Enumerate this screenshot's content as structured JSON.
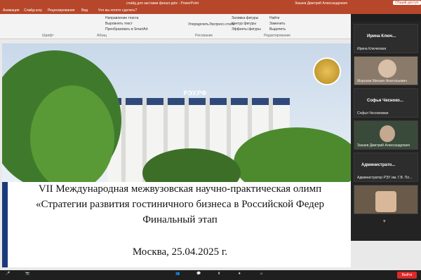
{
  "window": {
    "document_title": "слайд для заставки финал.pptx - PowerPoint",
    "user_name": "Закаев Дмитрий Александрович",
    "share_label": "Общий доступ"
  },
  "menu": {
    "items": [
      "Анимация",
      "Слайд-шоу",
      "Рецензирование",
      "Вид",
      "Что вы хотите сделать?"
    ]
  },
  "ribbon": {
    "groups": [
      "Шрифт",
      "Абзац",
      "Рисование",
      "Редактирование"
    ],
    "buttons": [
      "Направление текста",
      "Выровнять текст",
      "Преобразовать в SmartArt",
      "Упорядочить",
      "Экспресс-стили",
      "Заливка фигуры",
      "Контур фигуры",
      "Эффекты фигуры",
      "Найти",
      "Заменить",
      "Выделить"
    ]
  },
  "slide": {
    "sign_text": "РЭУ.РФ",
    "line1": "VII Международная межвузовская научно-практическая олимп",
    "line2": "«Стратегии развития гостиничного бизнеса в Российской Федер",
    "line3": "Финальный этап",
    "line4": "Москва, 25.04.2025 г."
  },
  "participants": [
    {
      "display": "Ирина Ключ...",
      "full": "Ирина Ключковая"
    },
    {
      "display": "",
      "full": "Морозов Михаил Анатольевич"
    },
    {
      "display": "Софья Чесноко...",
      "full": "Софья Чесноковая"
    },
    {
      "display": "",
      "full": "Закаев Дмитрий Александрович"
    },
    {
      "display": "Администрато...",
      "full": "Администратор РЭУ им. Г.В. Пл..."
    },
    {
      "display": "",
      "full": ""
    }
  ],
  "toolbar": {
    "leave_label": "Выйти"
  }
}
